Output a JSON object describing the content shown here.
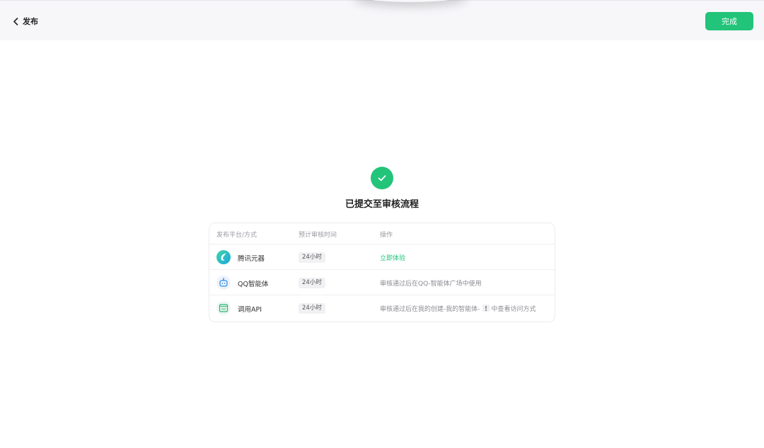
{
  "header": {
    "back_label": "发布",
    "done_label": "完成"
  },
  "result": {
    "title": "已提交至审核流程"
  },
  "table": {
    "columns": [
      "发布平台/方式",
      "预计审核时间",
      "操作"
    ],
    "rows": [
      {
        "platform": "腾讯元器",
        "icon": "yuanqi-logo-icon",
        "time": "24小时",
        "action": "立即体验"
      },
      {
        "platform": "QQ智能体",
        "icon": "qq-robot-icon",
        "time": "24小时",
        "action": "审核通过后在QQ-智能体广场中使用"
      },
      {
        "platform": "调用API",
        "icon": "api-icon",
        "time": "24小时",
        "action_prefix": "审核通过后在我的创建-我的智能体-",
        "action_suffix": "中查看访问方式"
      }
    ]
  },
  "colors": {
    "accent": "#22c47a",
    "header_bg": "#f7f7fa"
  }
}
